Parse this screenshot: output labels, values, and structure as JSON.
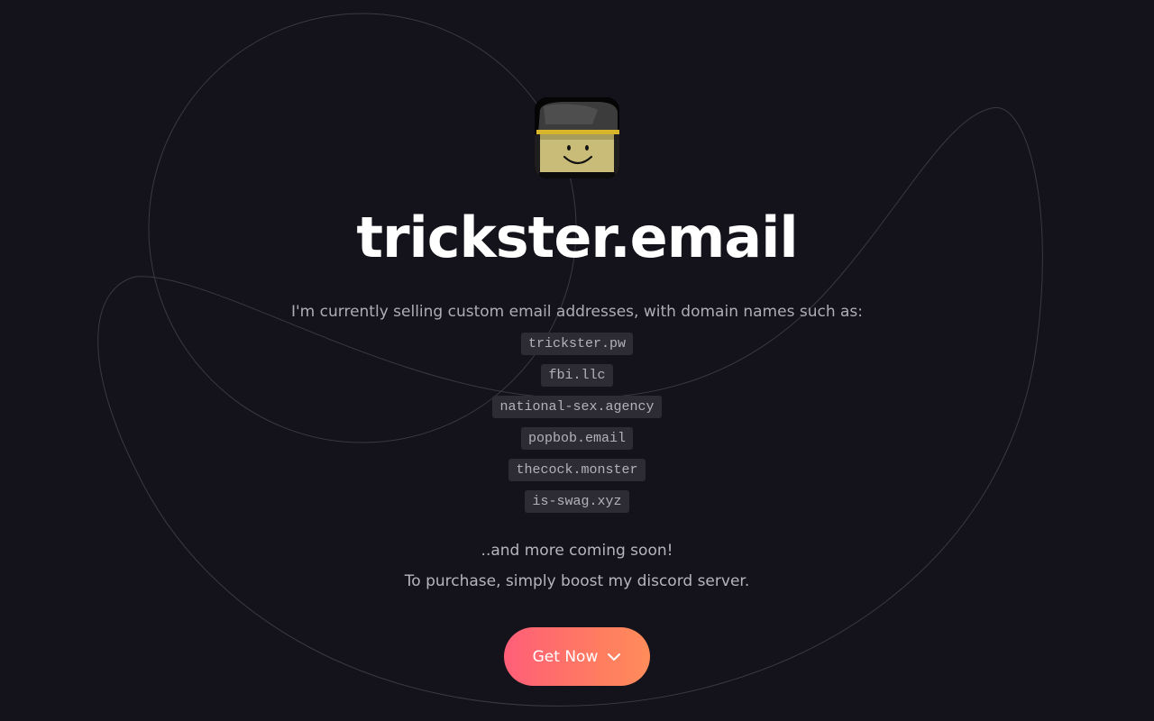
{
  "header": {
    "title": "trickster.email",
    "avatar_icon": "roblox-noob-with-hat-avatar"
  },
  "main": {
    "intro": "I'm currently selling custom email addresses, with domain names such as:",
    "domains": [
      "trickster.pw",
      "fbi.llc",
      "national-sex.agency",
      "popbob.email",
      "thecock.monster",
      "is-swag.xyz"
    ],
    "more_text": "..and more coming soon!",
    "purchase_text": "To purchase, simply boost my discord server."
  },
  "cta": {
    "label": "Get Now",
    "icon": "chevron-down-icon",
    "gradient_start": "#ff5e78",
    "gradient_end": "#ff8c5a"
  },
  "colors": {
    "background": "#14131b",
    "title": "#ffffff",
    "body_text": "#aeadb5",
    "chip_bg": "#2d2c34"
  }
}
